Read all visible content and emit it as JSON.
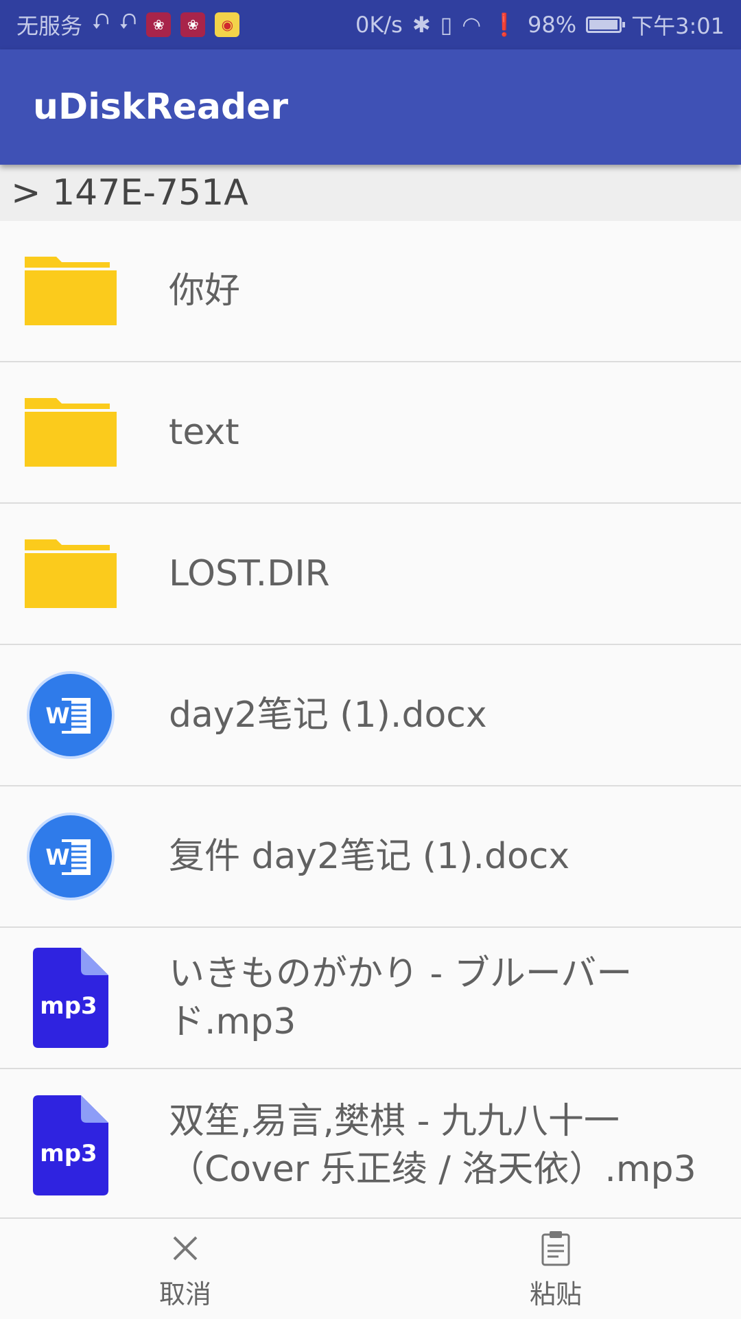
{
  "status_bar": {
    "carrier": "无服务",
    "network_speed": "0K/s",
    "battery_percent": "98%",
    "battery_level": 0.98,
    "time": "下午3:01"
  },
  "app_bar": {
    "title": "uDiskReader"
  },
  "breadcrumb": {
    "path": "> 147E-751A"
  },
  "files": [
    {
      "name": "你好",
      "type": "folder"
    },
    {
      "name": "text",
      "type": "folder"
    },
    {
      "name": "LOST.DIR",
      "type": "folder"
    },
    {
      "name": "day2笔记 (1).docx",
      "type": "docx"
    },
    {
      "name": "复件 day2笔记 (1).docx",
      "type": "docx"
    },
    {
      "name": "いきものがかり - ブルーバード.mp3",
      "type": "mp3"
    },
    {
      "name": "双笙,易言,樊棋 - 九九八十一（Cover 乐正绫 / 洛天依）.mp3",
      "type": "mp3"
    }
  ],
  "icons": {
    "docx_letter": "W",
    "mp3_label": "mp3",
    "folder_color": "#fbcb1c",
    "docx_color": "#2f7bea",
    "mp3_color": "#2f23e0"
  },
  "bottom_bar": {
    "cancel_label": "取消",
    "paste_label": "粘贴"
  },
  "colors": {
    "status_bar": "#303f9f",
    "app_bar": "#3f51b5"
  }
}
